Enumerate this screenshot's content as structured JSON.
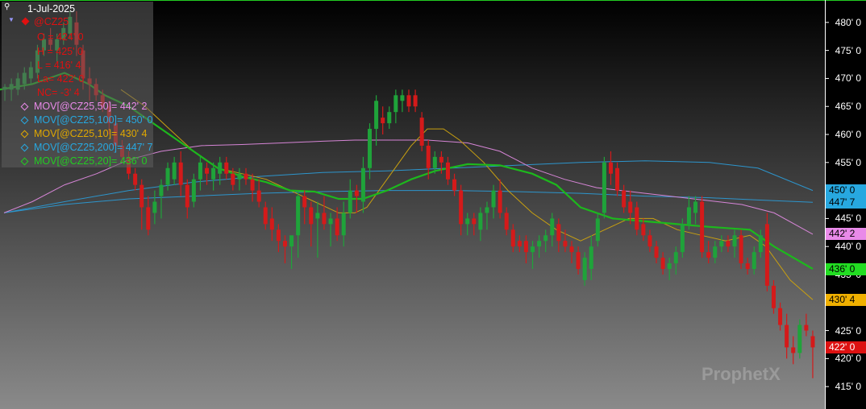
{
  "header": {
    "date": "1-Jul-2025",
    "symbol": "@CZ25"
  },
  "ohlc": {
    "open": "O = 424' 0",
    "high": "H = 425' 0",
    "low": "L = 416' 4",
    "last": "La= 422' 0",
    "net_change": "NC= -3' 4"
  },
  "studies": [
    {
      "label": "MOV[@CZ25,50]= 442' 2",
      "color": "#e98ae9"
    },
    {
      "label": "MOV[@CZ25,100]= 450' 0",
      "color": "#27a8e0"
    },
    {
      "label": "MOV[@CZ25,10]= 430' 4",
      "color": "#e0a800"
    },
    {
      "label": "MOV[@CZ25,200]= 447' 7",
      "color": "#27a8e0"
    },
    {
      "label": "MOV[@CZ25,20]= 436' 0",
      "color": "#22cc22"
    }
  ],
  "price_boxes": [
    {
      "text": "450' 0",
      "value": 450.0,
      "bg": "#27a8e0",
      "fg": "#000000"
    },
    {
      "text": "447' 7",
      "value": 447.875,
      "bg": "#27a8e0",
      "fg": "#000000"
    },
    {
      "text": "442' 2",
      "value": 442.25,
      "bg": "#e98ae9",
      "fg": "#000000"
    },
    {
      "text": "436' 0",
      "value": 436.0,
      "bg": "#22dd22",
      "fg": "#000000"
    },
    {
      "text": "430' 4",
      "value": 430.5,
      "bg": "#f0b000",
      "fg": "#000000"
    },
    {
      "text": "422' 0",
      "value": 422.0,
      "bg": "#dd1111",
      "fg": "#ffffff"
    }
  ],
  "watermark": "ProphetX",
  "colors": {
    "up": "#1fa33a",
    "down": "#d41a1a",
    "ma20": "#1db81d",
    "ma10": "#c9a010",
    "ma50": "#d685d6",
    "ma100": "#2d95cc",
    "ma200": "#2d95cc"
  },
  "chart_data": {
    "type": "candlestick",
    "ylim": [
      411,
      484
    ],
    "y_ticks": [
      415,
      420,
      425,
      430,
      435,
      440,
      445,
      450,
      455,
      460,
      465,
      470,
      475,
      480
    ],
    "y_tick_labels": [
      "415' 0",
      "420' 0",
      "425' 0",
      "430' 0",
      "435' 0",
      "440' 0",
      "445' 0",
      "450' 0",
      "455' 0",
      "460' 0",
      "465' 0",
      "470' 0",
      "475' 0",
      "480' 0"
    ],
    "candles": [
      {
        "o": 468,
        "h": 469,
        "l": 466,
        "c": 468.5
      },
      {
        "o": 468,
        "h": 470,
        "l": 466,
        "c": 469
      },
      {
        "o": 468,
        "h": 471,
        "l": 467,
        "c": 470
      },
      {
        "o": 469,
        "h": 472,
        "l": 468,
        "c": 471
      },
      {
        "o": 470,
        "h": 473,
        "l": 469,
        "c": 472
      },
      {
        "o": 471,
        "h": 476,
        "l": 470,
        "c": 475
      },
      {
        "o": 475,
        "h": 478,
        "l": 474,
        "c": 477
      },
      {
        "o": 477,
        "h": 479,
        "l": 475,
        "c": 476
      },
      {
        "o": 475,
        "h": 478,
        "l": 473,
        "c": 477
      },
      {
        "o": 477,
        "h": 480,
        "l": 476,
        "c": 479
      },
      {
        "o": 478,
        "h": 482,
        "l": 477,
        "c": 481
      },
      {
        "o": 480,
        "h": 482,
        "l": 474,
        "c": 476
      },
      {
        "o": 475,
        "h": 476,
        "l": 468,
        "c": 470
      },
      {
        "o": 470,
        "h": 472,
        "l": 466,
        "c": 469
      },
      {
        "o": 469,
        "h": 470,
        "l": 466,
        "c": 467
      },
      {
        "o": 467,
        "h": 468,
        "l": 464,
        "c": 465
      },
      {
        "o": 465,
        "h": 466,
        "l": 460,
        "c": 462
      },
      {
        "o": 462,
        "h": 463,
        "l": 457,
        "c": 458
      },
      {
        "o": 458,
        "h": 459,
        "l": 455,
        "c": 456
      },
      {
        "o": 456,
        "h": 457,
        "l": 452,
        "c": 453
      },
      {
        "o": 453,
        "h": 454,
        "l": 450,
        "c": 451
      },
      {
        "o": 451,
        "h": 452,
        "l": 443,
        "c": 447
      },
      {
        "o": 447,
        "h": 449,
        "l": 442,
        "c": 443
      },
      {
        "o": 446,
        "h": 450,
        "l": 444,
        "c": 448
      },
      {
        "o": 449,
        "h": 452,
        "l": 445,
        "c": 451
      },
      {
        "o": 451,
        "h": 455,
        "l": 450,
        "c": 454
      },
      {
        "o": 452,
        "h": 456,
        "l": 451,
        "c": 455
      },
      {
        "o": 455,
        "h": 457,
        "l": 449,
        "c": 451
      },
      {
        "o": 451,
        "h": 452,
        "l": 445,
        "c": 447
      },
      {
        "o": 448,
        "h": 453,
        "l": 447,
        "c": 452
      },
      {
        "o": 452,
        "h": 456,
        "l": 450,
        "c": 455
      },
      {
        "o": 454,
        "h": 455,
        "l": 451,
        "c": 453
      },
      {
        "o": 452,
        "h": 455,
        "l": 450,
        "c": 454
      },
      {
        "o": 453,
        "h": 456,
        "l": 451,
        "c": 455
      },
      {
        "o": 455,
        "h": 456,
        "l": 452,
        "c": 453
      },
      {
        "o": 453,
        "h": 454,
        "l": 450,
        "c": 451
      },
      {
        "o": 452,
        "h": 454,
        "l": 450,
        "c": 453
      },
      {
        "o": 453,
        "h": 454,
        "l": 451,
        "c": 452
      },
      {
        "o": 452,
        "h": 453,
        "l": 448,
        "c": 450
      },
      {
        "o": 450,
        "h": 452,
        "l": 447,
        "c": 448
      },
      {
        "o": 447,
        "h": 448,
        "l": 443,
        "c": 444
      },
      {
        "o": 445,
        "h": 447,
        "l": 441,
        "c": 443
      },
      {
        "o": 443,
        "h": 444,
        "l": 439,
        "c": 441
      },
      {
        "o": 441,
        "h": 442,
        "l": 437,
        "c": 440
      },
      {
        "o": 440,
        "h": 441,
        "l": 436,
        "c": 442
      },
      {
        "o": 442,
        "h": 450,
        "l": 438,
        "c": 449
      },
      {
        "o": 449,
        "h": 450,
        "l": 444,
        "c": 447
      },
      {
        "o": 447,
        "h": 448,
        "l": 440,
        "c": 444
      },
      {
        "o": 445,
        "h": 448,
        "l": 438,
        "c": 446
      },
      {
        "o": 446,
        "h": 449,
        "l": 443,
        "c": 444
      },
      {
        "o": 444,
        "h": 446,
        "l": 440,
        "c": 445
      },
      {
        "o": 445,
        "h": 447,
        "l": 441,
        "c": 442
      },
      {
        "o": 442,
        "h": 448,
        "l": 440,
        "c": 446
      },
      {
        "o": 446,
        "h": 452,
        "l": 445,
        "c": 450
      },
      {
        "o": 450,
        "h": 451,
        "l": 446,
        "c": 449
      },
      {
        "o": 448,
        "h": 456,
        "l": 446,
        "c": 454
      },
      {
        "o": 454,
        "h": 462,
        "l": 452,
        "c": 461
      },
      {
        "o": 461,
        "h": 467,
        "l": 458,
        "c": 466
      },
      {
        "o": 463,
        "h": 465,
        "l": 460,
        "c": 462
      },
      {
        "o": 462,
        "h": 465,
        "l": 461,
        "c": 464
      },
      {
        "o": 464,
        "h": 468,
        "l": 462,
        "c": 467
      },
      {
        "o": 466,
        "h": 468,
        "l": 464,
        "c": 467
      },
      {
        "o": 467,
        "h": 468,
        "l": 464,
        "c": 465
      },
      {
        "o": 467,
        "h": 468,
        "l": 464,
        "c": 465
      },
      {
        "o": 463,
        "h": 464,
        "l": 457,
        "c": 458
      },
      {
        "o": 458,
        "h": 459,
        "l": 452,
        "c": 454
      },
      {
        "o": 454,
        "h": 457,
        "l": 453,
        "c": 456
      },
      {
        "o": 456,
        "h": 457,
        "l": 453,
        "c": 455
      },
      {
        "o": 455,
        "h": 456,
        "l": 451,
        "c": 452
      },
      {
        "o": 452,
        "h": 453,
        "l": 449,
        "c": 450
      },
      {
        "o": 450,
        "h": 451,
        "l": 442,
        "c": 444
      },
      {
        "o": 444,
        "h": 446,
        "l": 442,
        "c": 445
      },
      {
        "o": 445,
        "h": 446,
        "l": 442,
        "c": 444
      },
      {
        "o": 443,
        "h": 447,
        "l": 441,
        "c": 446
      },
      {
        "o": 446,
        "h": 448,
        "l": 443,
        "c": 447
      },
      {
        "o": 447,
        "h": 451,
        "l": 445,
        "c": 450
      },
      {
        "o": 450,
        "h": 452,
        "l": 445,
        "c": 446
      },
      {
        "o": 446,
        "h": 447,
        "l": 442,
        "c": 443
      },
      {
        "o": 443,
        "h": 444,
        "l": 439,
        "c": 440
      },
      {
        "o": 441,
        "h": 442,
        "l": 439,
        "c": 440
      },
      {
        "o": 441,
        "h": 442,
        "l": 437,
        "c": 439
      },
      {
        "o": 439,
        "h": 441,
        "l": 436,
        "c": 440
      },
      {
        "o": 440,
        "h": 442,
        "l": 438,
        "c": 441
      },
      {
        "o": 441,
        "h": 443,
        "l": 439,
        "c": 442
      },
      {
        "o": 442,
        "h": 446,
        "l": 440,
        "c": 445
      },
      {
        "o": 444,
        "h": 445,
        "l": 439,
        "c": 441
      },
      {
        "o": 441,
        "h": 443,
        "l": 439,
        "c": 440
      },
      {
        "o": 440,
        "h": 441,
        "l": 437,
        "c": 439
      },
      {
        "o": 439,
        "h": 440,
        "l": 435,
        "c": 436
      },
      {
        "o": 434,
        "h": 439,
        "l": 433,
        "c": 438
      },
      {
        "o": 436,
        "h": 442,
        "l": 434,
        "c": 440
      },
      {
        "o": 441,
        "h": 446,
        "l": 440,
        "c": 445
      },
      {
        "o": 446,
        "h": 456,
        "l": 445,
        "c": 455
      },
      {
        "o": 455,
        "h": 457,
        "l": 451,
        "c": 453
      },
      {
        "o": 454,
        "h": 455,
        "l": 449,
        "c": 450
      },
      {
        "o": 450,
        "h": 451,
        "l": 446,
        "c": 447
      },
      {
        "o": 448,
        "h": 450,
        "l": 444,
        "c": 446
      },
      {
        "o": 447,
        "h": 448,
        "l": 442,
        "c": 443
      },
      {
        "o": 444,
        "h": 445,
        "l": 441,
        "c": 442
      },
      {
        "o": 442,
        "h": 443,
        "l": 439,
        "c": 440
      },
      {
        "o": 440,
        "h": 441,
        "l": 437,
        "c": 438
      },
      {
        "o": 438,
        "h": 439,
        "l": 435,
        "c": 436
      },
      {
        "o": 436,
        "h": 438,
        "l": 434,
        "c": 437
      },
      {
        "o": 437,
        "h": 440,
        "l": 435,
        "c": 439
      },
      {
        "o": 439,
        "h": 445,
        "l": 438,
        "c": 444
      },
      {
        "o": 444,
        "h": 449,
        "l": 443,
        "c": 447
      },
      {
        "o": 446,
        "h": 449,
        "l": 444,
        "c": 448
      },
      {
        "o": 448,
        "h": 449,
        "l": 438,
        "c": 439
      },
      {
        "o": 439,
        "h": 441,
        "l": 437,
        "c": 438
      },
      {
        "o": 438,
        "h": 441,
        "l": 437,
        "c": 440
      },
      {
        "o": 440,
        "h": 442,
        "l": 439,
        "c": 441
      },
      {
        "o": 441,
        "h": 442,
        "l": 439,
        "c": 440
      },
      {
        "o": 440,
        "h": 443,
        "l": 438,
        "c": 442
      },
      {
        "o": 442,
        "h": 443,
        "l": 436,
        "c": 437
      },
      {
        "o": 437,
        "h": 438,
        "l": 435,
        "c": 436
      },
      {
        "o": 436,
        "h": 440,
        "l": 435,
        "c": 439
      },
      {
        "o": 439,
        "h": 443,
        "l": 438,
        "c": 442
      },
      {
        "o": 444,
        "h": 446,
        "l": 432,
        "c": 433
      },
      {
        "o": 433,
        "h": 434,
        "l": 428,
        "c": 429
      },
      {
        "o": 429,
        "h": 430,
        "l": 425,
        "c": 426
      },
      {
        "o": 426,
        "h": 428,
        "l": 420,
        "c": 422
      },
      {
        "o": 422,
        "h": 424,
        "l": 419,
        "c": 421
      },
      {
        "o": 421,
        "h": 427,
        "l": 420,
        "c": 426
      },
      {
        "o": 426,
        "h": 428,
        "l": 424,
        "c": 425
      },
      {
        "o": 424,
        "h": 425,
        "l": 416.5,
        "c": 422
      }
    ],
    "ma20": [
      [
        0,
        468
      ],
      [
        40,
        469
      ],
      [
        80,
        471
      ],
      [
        110,
        469
      ],
      [
        130,
        467
      ],
      [
        160,
        465
      ],
      [
        200,
        461
      ],
      [
        240,
        457
      ],
      [
        270,
        454
      ],
      [
        300,
        452.5
      ],
      [
        330,
        451.5
      ],
      [
        360,
        450
      ],
      [
        390,
        449.8
      ],
      [
        420,
        448.5
      ],
      [
        450,
        448.5
      ],
      [
        480,
        450
      ],
      [
        510,
        452
      ],
      [
        540,
        453.5
      ],
      [
        580,
        454.7
      ],
      [
        620,
        454.5
      ],
      [
        660,
        453
      ],
      [
        690,
        451
      ],
      [
        720,
        447
      ],
      [
        760,
        445
      ],
      [
        800,
        444.5
      ],
      [
        840,
        444
      ],
      [
        880,
        443.5
      ],
      [
        930,
        443
      ],
      [
        960,
        440
      ],
      [
        1008,
        436
      ]
    ],
    "ma10": [
      [
        150,
        468
      ],
      [
        180,
        465
      ],
      [
        210,
        461
      ],
      [
        240,
        457
      ],
      [
        270,
        454
      ],
      [
        300,
        453
      ],
      [
        330,
        452
      ],
      [
        360,
        450
      ],
      [
        390,
        448
      ],
      [
        420,
        446
      ],
      [
        440,
        446
      ],
      [
        455,
        447
      ],
      [
        480,
        452
      ],
      [
        510,
        458
      ],
      [
        530,
        461
      ],
      [
        550,
        461
      ],
      [
        570,
        459
      ],
      [
        600,
        455
      ],
      [
        630,
        450
      ],
      [
        660,
        446
      ],
      [
        690,
        443
      ],
      [
        720,
        441
      ],
      [
        750,
        443
      ],
      [
        780,
        445
      ],
      [
        810,
        445
      ],
      [
        840,
        443
      ],
      [
        870,
        442
      ],
      [
        900,
        441
      ],
      [
        930,
        442
      ],
      [
        950,
        440
      ],
      [
        980,
        434
      ],
      [
        1008,
        430.5
      ]
    ],
    "ma50": [
      [
        5,
        446
      ],
      [
        40,
        448
      ],
      [
        80,
        451
      ],
      [
        120,
        453
      ],
      [
        160,
        455.5
      ],
      [
        200,
        457
      ],
      [
        250,
        458
      ],
      [
        300,
        458.2
      ],
      [
        350,
        458.5
      ],
      [
        400,
        458.8
      ],
      [
        440,
        459
      ],
      [
        480,
        459
      ],
      [
        530,
        459
      ],
      [
        580,
        458.5
      ],
      [
        620,
        457
      ],
      [
        660,
        454
      ],
      [
        700,
        452
      ],
      [
        740,
        450.5
      ],
      [
        800,
        449.5
      ],
      [
        860,
        448.5
      ],
      [
        920,
        447.5
      ],
      [
        960,
        446
      ],
      [
        1008,
        442.2
      ]
    ],
    "ma100": [
      [
        5,
        446
      ],
      [
        80,
        448
      ],
      [
        160,
        450
      ],
      [
        240,
        451.5
      ],
      [
        320,
        452.5
      ],
      [
        400,
        453.2
      ],
      [
        480,
        453.5
      ],
      [
        560,
        454
      ],
      [
        640,
        454.5
      ],
      [
        720,
        455
      ],
      [
        800,
        455.3
      ],
      [
        880,
        455
      ],
      [
        940,
        454
      ],
      [
        1008,
        450
      ]
    ],
    "ma200": [
      [
        5,
        446
      ],
      [
        80,
        447.5
      ],
      [
        160,
        448.5
      ],
      [
        240,
        449
      ],
      [
        320,
        449.5
      ],
      [
        400,
        449.8
      ],
      [
        480,
        450
      ],
      [
        560,
        450
      ],
      [
        640,
        449.8
      ],
      [
        720,
        449.5
      ],
      [
        800,
        449
      ],
      [
        880,
        448.7
      ],
      [
        940,
        448.3
      ],
      [
        1008,
        447.9
      ]
    ]
  }
}
